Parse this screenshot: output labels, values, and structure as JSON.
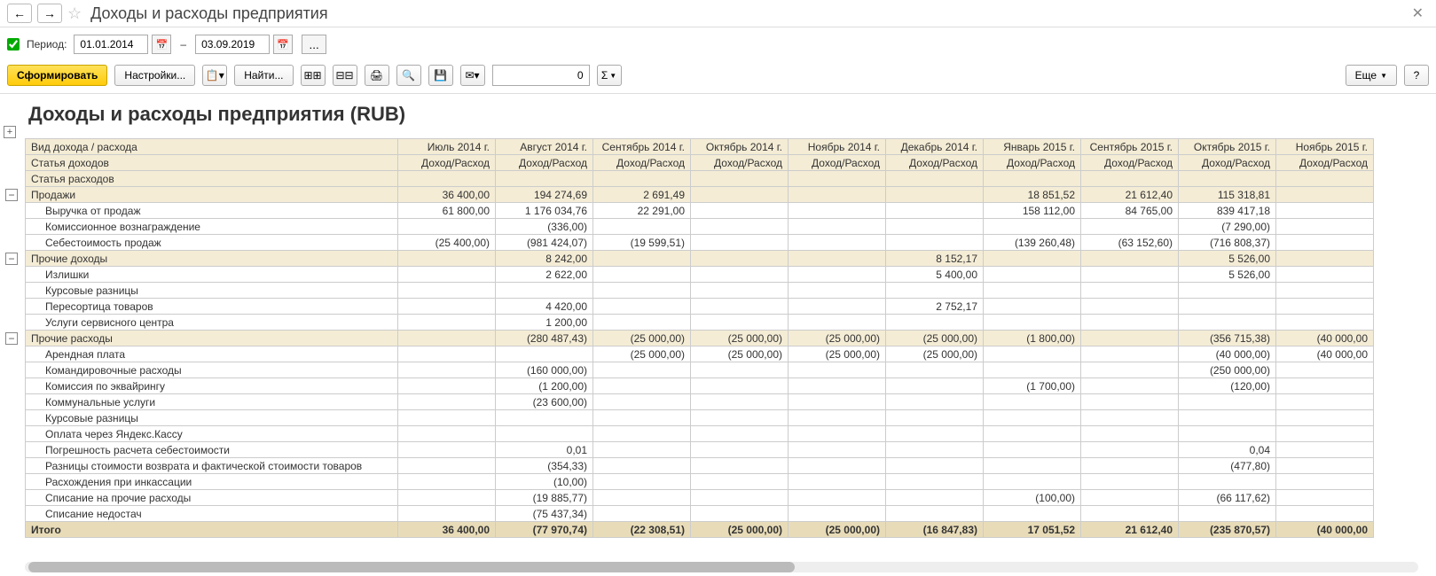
{
  "title": "Доходы и расходы предприятия",
  "close_glyph": "✕",
  "nav": {
    "back": "←",
    "fwd": "→",
    "star": "☆"
  },
  "period": {
    "label": "Период:",
    "checked": true,
    "from": "01.01.2014",
    "to": "03.09.2019",
    "cal_glyph": "📅",
    "dash": "–",
    "dots": "..."
  },
  "toolbar": {
    "form": "Сформировать",
    "settings": "Настройки...",
    "find": "Найти...",
    "num_value": "0",
    "sigma": "Σ",
    "more": "Еще",
    "help": "?",
    "icons": {
      "paste": "📋▾",
      "expand": "⊞⊞",
      "collapse": "⊟⊟",
      "print": "🖨",
      "preview": "🔍",
      "save": "💾",
      "mail": "✉▾"
    }
  },
  "report": {
    "heading": "Доходы и расходы предприятия (RUB)",
    "col0_labels": [
      "Вид дохода / расхода",
      "Статья доходов",
      "Статья расходов"
    ],
    "sub_label": "Доход/Расход",
    "periods": [
      "Июль 2014 г.",
      "Август 2014 г.",
      "Сентябрь 2014 г.",
      "Октябрь 2014 г.",
      "Ноябрь 2014 г.",
      "Декабрь 2014 г.",
      "Январь 2015 г.",
      "Сентябрь 2015 г.",
      "Октябрь 2015 г.",
      "Ноябрь 2015 г."
    ],
    "rows": [
      {
        "type": "group",
        "label": "Продажи",
        "vals": [
          "36 400,00",
          "194 274,69",
          "2 691,49",
          "",
          "",
          "",
          "18 851,52",
          "21 612,40",
          "115 318,81",
          ""
        ]
      },
      {
        "type": "item",
        "label": "Выручка от продаж",
        "vals": [
          "61 800,00",
          "1 176 034,76",
          "22 291,00",
          "",
          "",
          "",
          "158 112,00",
          "84 765,00",
          "839 417,18",
          ""
        ]
      },
      {
        "type": "item",
        "label": "Комиссионное вознаграждение",
        "vals": [
          "",
          "(336,00)",
          "",
          "",
          "",
          "",
          "",
          "",
          "(7 290,00)",
          ""
        ]
      },
      {
        "type": "item",
        "label": "Себестоимость продаж",
        "vals": [
          "(25 400,00)",
          "(981 424,07)",
          "(19 599,51)",
          "",
          "",
          "",
          "(139 260,48)",
          "(63 152,60)",
          "(716 808,37)",
          ""
        ]
      },
      {
        "type": "group",
        "label": "Прочие доходы",
        "vals": [
          "",
          "8 242,00",
          "",
          "",
          "",
          "8 152,17",
          "",
          "",
          "5 526,00",
          ""
        ]
      },
      {
        "type": "item",
        "label": "Излишки",
        "vals": [
          "",
          "2 622,00",
          "",
          "",
          "",
          "5 400,00",
          "",
          "",
          "5 526,00",
          ""
        ]
      },
      {
        "type": "item",
        "label": "Курсовые разницы",
        "vals": [
          "",
          "",
          "",
          "",
          "",
          "",
          "",
          "",
          "",
          ""
        ]
      },
      {
        "type": "item",
        "label": "Пересортица товаров",
        "vals": [
          "",
          "4 420,00",
          "",
          "",
          "",
          "2 752,17",
          "",
          "",
          "",
          ""
        ]
      },
      {
        "type": "item",
        "label": "Услуги сервисного центра",
        "vals": [
          "",
          "1 200,00",
          "",
          "",
          "",
          "",
          "",
          "",
          "",
          ""
        ]
      },
      {
        "type": "group",
        "label": "Прочие расходы",
        "vals": [
          "",
          "(280 487,43)",
          "(25 000,00)",
          "(25 000,00)",
          "(25 000,00)",
          "(25 000,00)",
          "(1 800,00)",
          "",
          "(356 715,38)",
          "(40 000,00"
        ]
      },
      {
        "type": "item",
        "label": "Арендная плата",
        "vals": [
          "",
          "",
          "(25 000,00)",
          "(25 000,00)",
          "(25 000,00)",
          "(25 000,00)",
          "",
          "",
          "(40 000,00)",
          "(40 000,00"
        ]
      },
      {
        "type": "item",
        "label": "Командировочные расходы",
        "vals": [
          "",
          "(160 000,00)",
          "",
          "",
          "",
          "",
          "",
          "",
          "(250 000,00)",
          ""
        ]
      },
      {
        "type": "item",
        "label": "Комиссия по эквайрингу",
        "vals": [
          "",
          "(1 200,00)",
          "",
          "",
          "",
          "",
          "(1 700,00)",
          "",
          "(120,00)",
          ""
        ]
      },
      {
        "type": "item",
        "label": "Коммунальные услуги",
        "vals": [
          "",
          "(23 600,00)",
          "",
          "",
          "",
          "",
          "",
          "",
          "",
          ""
        ]
      },
      {
        "type": "item",
        "label": "Курсовые разницы",
        "vals": [
          "",
          "",
          "",
          "",
          "",
          "",
          "",
          "",
          "",
          ""
        ]
      },
      {
        "type": "item",
        "label": "Оплата через Яндекс.Кассу",
        "vals": [
          "",
          "",
          "",
          "",
          "",
          "",
          "",
          "",
          "",
          ""
        ]
      },
      {
        "type": "item",
        "label": "Погрешность расчета себестоимости",
        "vals": [
          "",
          "0,01",
          "",
          "",
          "",
          "",
          "",
          "",
          "0,04",
          ""
        ]
      },
      {
        "type": "item",
        "label": "Разницы стоимости возврата и фактической стоимости товаров",
        "vals": [
          "",
          "(354,33)",
          "",
          "",
          "",
          "",
          "",
          "",
          "(477,80)",
          ""
        ]
      },
      {
        "type": "item",
        "label": "Расхождения при инкассации",
        "vals": [
          "",
          "(10,00)",
          "",
          "",
          "",
          "",
          "",
          "",
          "",
          ""
        ]
      },
      {
        "type": "item",
        "label": "Списание на прочие расходы",
        "vals": [
          "",
          "(19 885,77)",
          "",
          "",
          "",
          "",
          "(100,00)",
          "",
          "(66 117,62)",
          ""
        ]
      },
      {
        "type": "item",
        "label": "Списание недостач",
        "vals": [
          "",
          "(75 437,34)",
          "",
          "",
          "",
          "",
          "",
          "",
          "",
          ""
        ]
      }
    ],
    "total": {
      "label": "Итого",
      "vals": [
        "36 400,00",
        "(77 970,74)",
        "(22 308,51)",
        "(25 000,00)",
        "(25 000,00)",
        "(16 847,83)",
        "17 051,52",
        "21 612,40",
        "(235 870,57)",
        "(40 000,00"
      ]
    }
  }
}
